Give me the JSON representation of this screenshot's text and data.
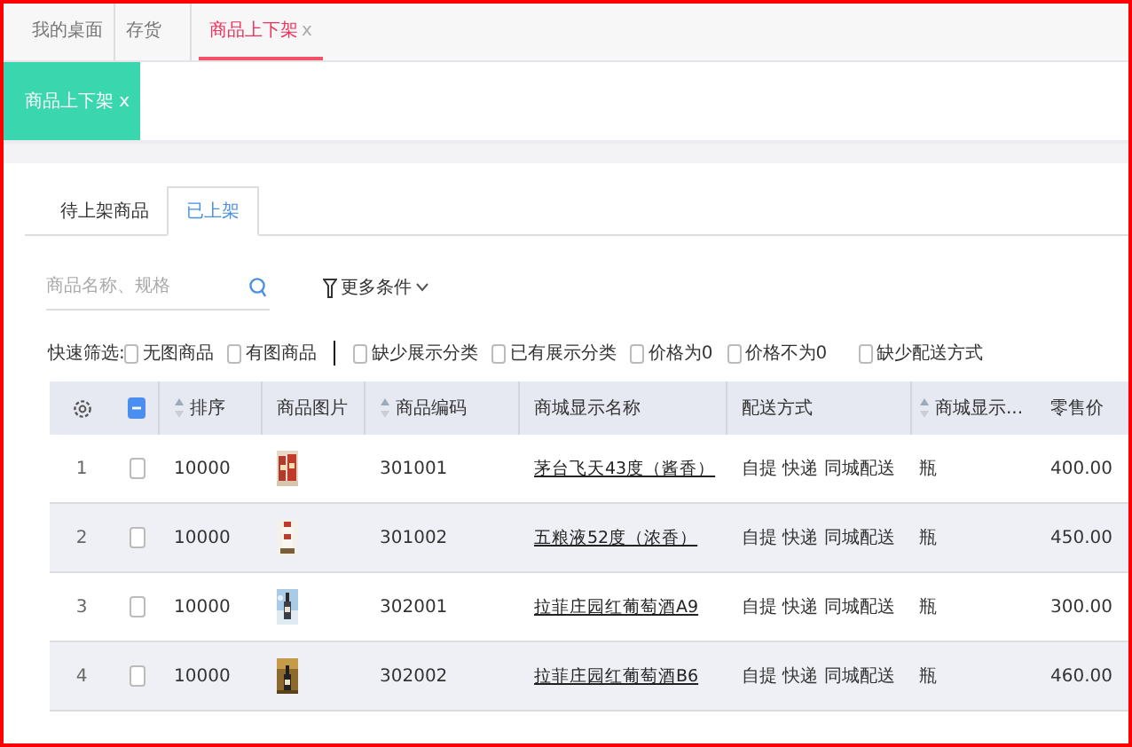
{
  "top_tabs": [
    {
      "label": "我的桌面",
      "selected": false,
      "closable": false
    },
    {
      "label": "存货",
      "selected": false,
      "closable": false
    },
    {
      "label": "商品上下架",
      "selected": true,
      "closable": true,
      "close": "x"
    }
  ],
  "page_tag": {
    "label": "商品上下架",
    "close": "x"
  },
  "sub_tabs": [
    {
      "label": "待上架商品",
      "selected": false
    },
    {
      "label": "已上架",
      "selected": true
    }
  ],
  "search": {
    "placeholder": "商品名称、规格"
  },
  "more_filters": {
    "label": "更多条件"
  },
  "quick_filter": {
    "label": "快速筛选:",
    "groups": [
      [
        {
          "label": "无图商品",
          "checked": false
        },
        {
          "label": "有图商品",
          "checked": false
        }
      ],
      [
        {
          "label": "缺少展示分类",
          "checked": false
        },
        {
          "label": "已有展示分类",
          "checked": false
        },
        {
          "label": "价格为0",
          "checked": false
        },
        {
          "label": "价格不为0",
          "checked": false
        },
        {
          "label": "缺少配送方式",
          "checked": false
        }
      ]
    ]
  },
  "table": {
    "columns": [
      {
        "kind": "settings"
      },
      {
        "kind": "select"
      },
      {
        "kind": "text",
        "label": "排序",
        "sortable": true
      },
      {
        "kind": "text",
        "label": "商品图片",
        "sortable": false
      },
      {
        "kind": "text",
        "label": "商品编码",
        "sortable": true
      },
      {
        "kind": "text",
        "label": "商城显示名称",
        "sortable": false
      },
      {
        "kind": "text",
        "label": "配送方式",
        "sortable": false
      },
      {
        "kind": "text",
        "label": "商城显示...",
        "sortable": true
      },
      {
        "kind": "text",
        "label": "零售价",
        "sortable": false
      }
    ],
    "rows": [
      {
        "index": "1",
        "selected": false,
        "sort": "10000",
        "code": "301001",
        "name": "茅台飞天43度（酱香）",
        "delivery": "自提 快递 同城配送",
        "unit": "瓶",
        "price": "400.00"
      },
      {
        "index": "2",
        "selected": false,
        "sort": "10000",
        "code": "301002",
        "name": "五粮液52度（浓香）",
        "delivery": "自提 快递 同城配送",
        "unit": "瓶",
        "price": "450.00"
      },
      {
        "index": "3",
        "selected": false,
        "sort": "10000",
        "code": "302001",
        "name": "拉菲庄园红葡萄酒A9",
        "delivery": "自提 快递 同城配送",
        "unit": "瓶",
        "price": "300.00"
      },
      {
        "index": "4",
        "selected": false,
        "sort": "10000",
        "code": "302002",
        "name": "拉菲庄园红葡萄酒B6",
        "delivery": "自提 快递 同城配送",
        "unit": "瓶",
        "price": "460.00"
      }
    ]
  }
}
